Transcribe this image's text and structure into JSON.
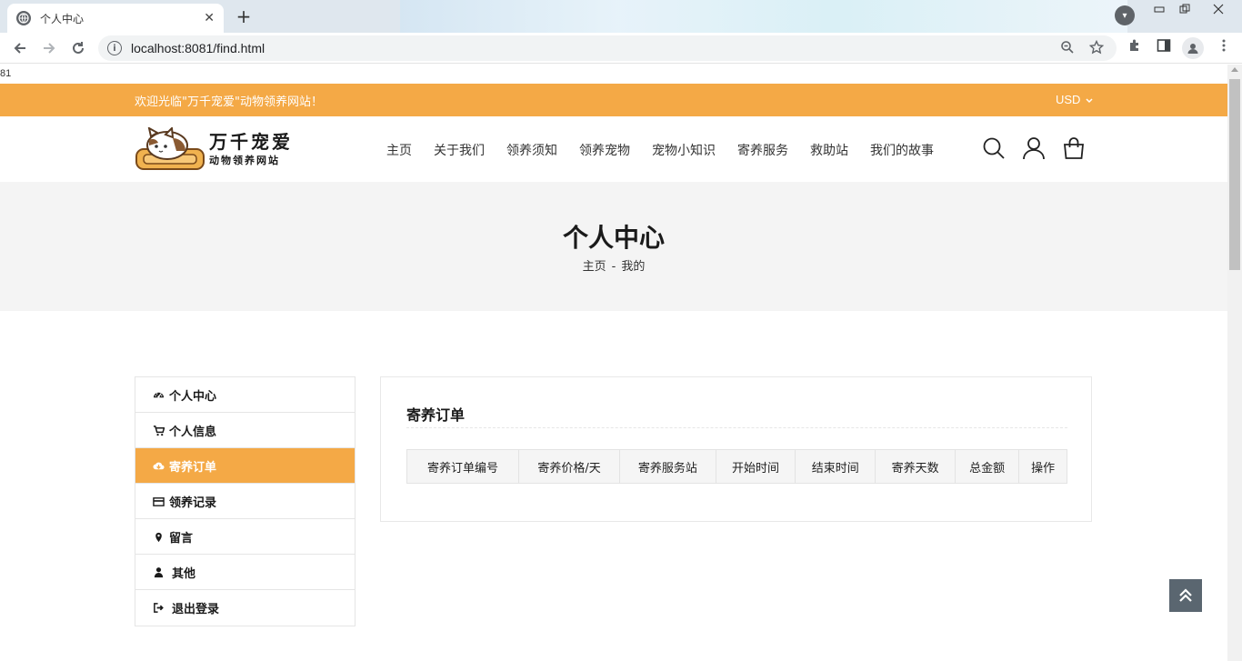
{
  "browser": {
    "tab_title": "个人中心",
    "url": "localhost:8081/find.html",
    "tab_close": "✕",
    "new_tab": "+"
  },
  "page": {
    "stray_text": "81",
    "topbar": {
      "welcome": "欢迎光临\"万千宠爱\"动物领养网站！",
      "currency": "USD"
    },
    "logo": {
      "line1": "万千宠爱",
      "line2": "动物领养网站"
    },
    "nav": [
      "主页",
      "关于我们",
      "领养须知",
      "领养宠物",
      "宠物小知识",
      "寄养服务",
      "救助站",
      "我们的故事"
    ],
    "banner": {
      "title": "个人中心",
      "crumb_home": "主页",
      "crumb_sep": "-",
      "crumb_current": "我的"
    },
    "sidebar": [
      {
        "label": "个人中心",
        "icon": "dashboard-icon"
      },
      {
        "label": "个人信息",
        "icon": "cart-icon"
      },
      {
        "label": "寄养订单",
        "icon": "cloud-download-icon",
        "active": true
      },
      {
        "label": "领养记录",
        "icon": "credit-card-icon"
      },
      {
        "label": "留言",
        "icon": "map-marker-icon"
      },
      {
        "label": "其他",
        "icon": "user-icon"
      },
      {
        "label": "退出登录",
        "icon": "sign-out-icon"
      }
    ],
    "panel": {
      "title": "寄养订单",
      "columns": [
        "寄养订单编号",
        "寄养价格/天",
        "寄养服务站",
        "开始时间",
        "结束时间",
        "寄养天数",
        "总金额",
        "操作"
      ]
    }
  },
  "colors": {
    "accent": "#f4a946",
    "banner_bg": "#f4f4f4",
    "to_top_bg": "#5a6670"
  }
}
